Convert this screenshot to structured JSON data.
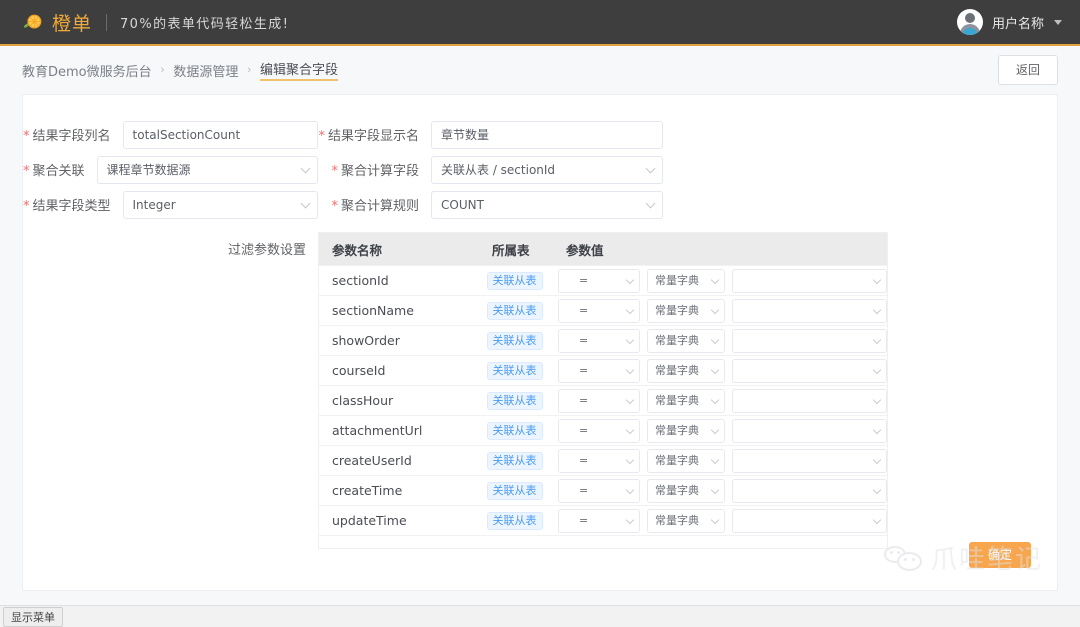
{
  "header": {
    "logo_icon": "orange-slice-icon",
    "brand": "橙单",
    "slogan": "70%的表单代码轻松生成!",
    "user_name": "用户名称",
    "avatar_icon": "user-avatar-icon",
    "caret_icon": "chevron-down-icon",
    "accent_color": "#e6a23c",
    "bg_color": "#3e3e3e"
  },
  "breadcrumb": {
    "items": [
      {
        "label": "教育Demo微服务后台",
        "current": false
      },
      {
        "label": "数据源管理",
        "current": false
      },
      {
        "label": "编辑聚合字段",
        "current": true
      }
    ],
    "separator": "›",
    "back_label": "返回"
  },
  "form": {
    "rows": [
      {
        "left": {
          "label": "结果字段列名",
          "required": true,
          "type": "input",
          "value": "totalSectionCount"
        },
        "right": {
          "label": "结果字段显示名",
          "required": true,
          "type": "input",
          "value": "章节数量"
        }
      },
      {
        "left": {
          "label": "聚合关联",
          "required": true,
          "type": "select",
          "value": "课程章节数据源"
        },
        "right": {
          "label": "聚合计算字段",
          "required": true,
          "type": "select",
          "value": "关联从表 / sectionId"
        }
      },
      {
        "left": {
          "label": "结果字段类型",
          "required": true,
          "type": "select",
          "value": "Integer"
        },
        "right": {
          "label": "聚合计算规则",
          "required": true,
          "type": "select",
          "value": "COUNT"
        }
      }
    ]
  },
  "filter_table": {
    "label": "过滤参数设置",
    "headers": [
      "参数名称",
      "所属表",
      "参数值"
    ],
    "badge_label": "关联从表",
    "operator_value": "=",
    "dict_value": "常量字典",
    "param_value": "",
    "badge_color": "#4a9cf6",
    "rows": [
      {
        "name": "sectionId"
      },
      {
        "name": "sectionName"
      },
      {
        "name": "showOrder"
      },
      {
        "name": "courseId"
      },
      {
        "name": "classHour"
      },
      {
        "name": "attachmentUrl"
      },
      {
        "name": "createUserId"
      },
      {
        "name": "createTime"
      },
      {
        "name": "updateTime"
      }
    ]
  },
  "actions": {
    "confirm_label": "确定",
    "confirm_color": "#f8a64e"
  },
  "watermark": {
    "text": "爪哇笔记",
    "icon": "wechat-icon"
  },
  "statusbar": {
    "menu_toggle_label": "显示菜单"
  }
}
